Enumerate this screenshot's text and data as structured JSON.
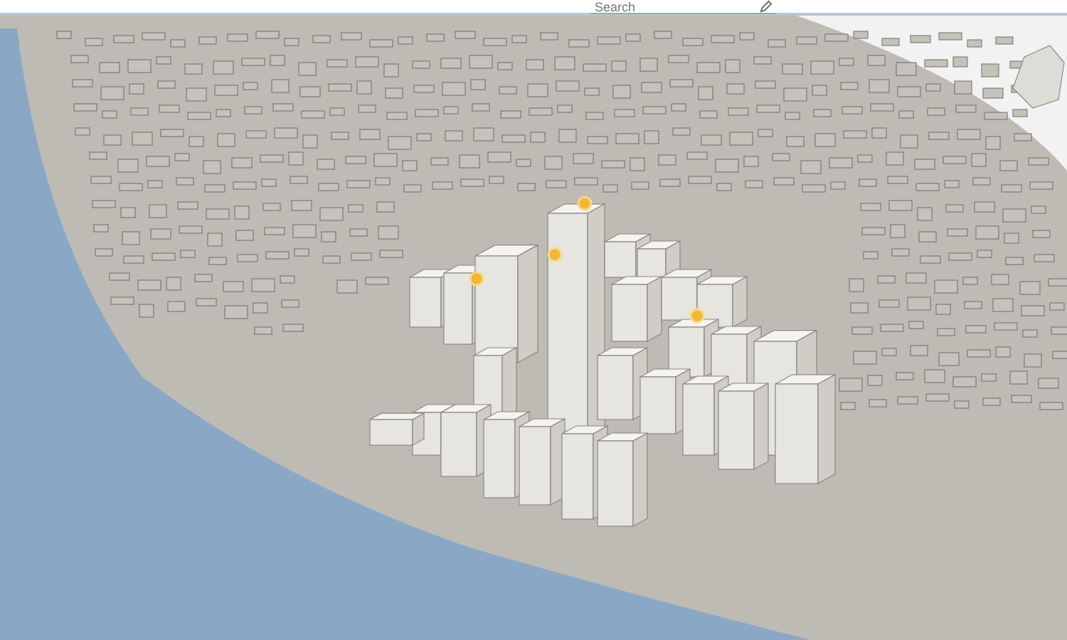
{
  "toolbar": {
    "search": {
      "placeholder": "Search"
    }
  },
  "scene": {
    "markers": [
      {
        "kind": "point"
      },
      {
        "kind": "point"
      },
      {
        "kind": "point"
      },
      {
        "kind": "point"
      }
    ]
  }
}
